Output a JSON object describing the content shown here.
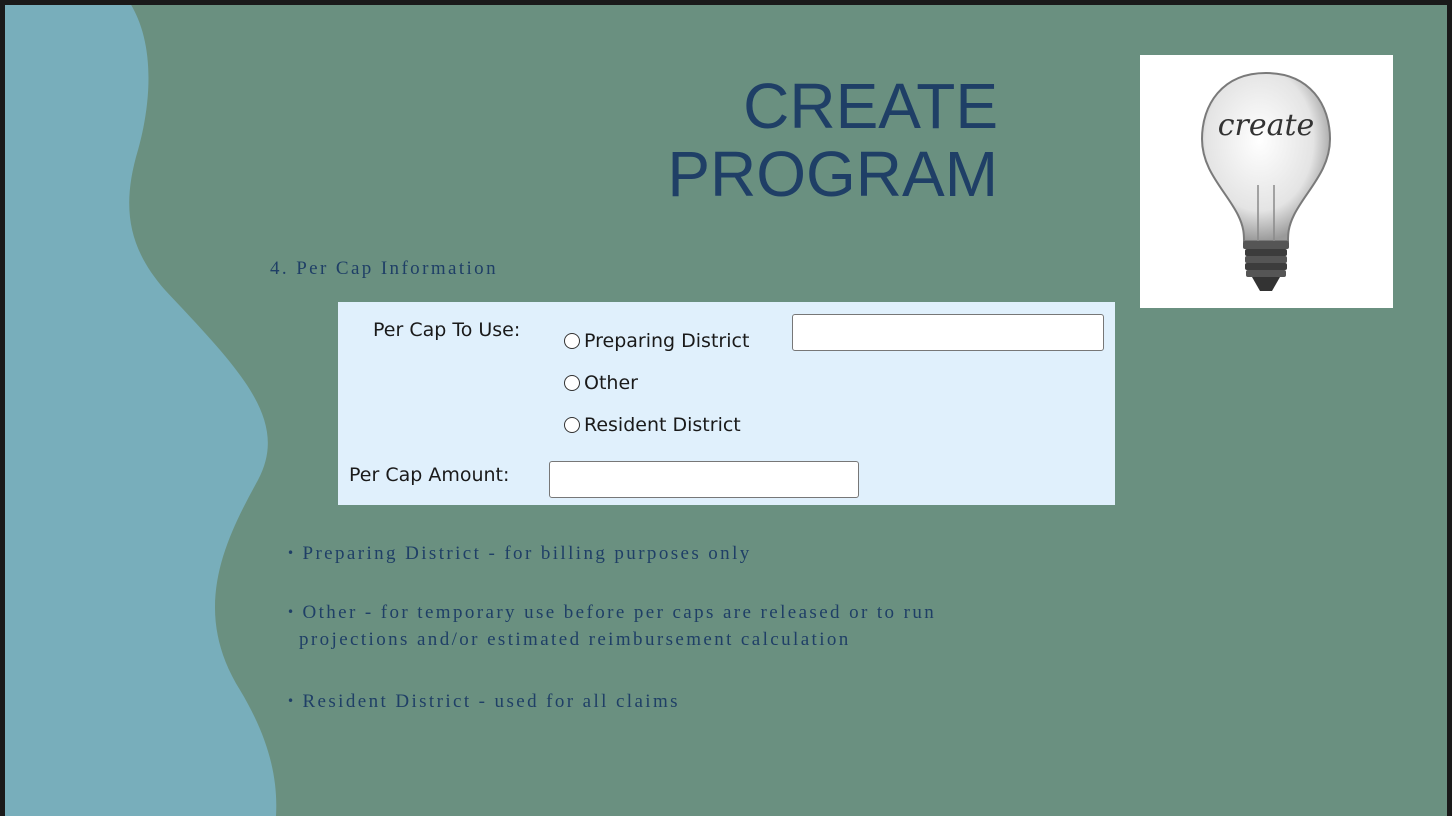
{
  "slide": {
    "title_line1": "CREATE",
    "title_line2": "PROGRAM",
    "bulb_word": "create",
    "section_heading": "4. Per Cap Information"
  },
  "form": {
    "per_cap_to_use_label": "Per Cap To Use:",
    "options": [
      {
        "label": "Preparing District",
        "selected": false
      },
      {
        "label": "Other",
        "selected": false
      },
      {
        "label": "Resident District",
        "selected": false
      }
    ],
    "preparing_district_value": "",
    "per_cap_amount_label": "Per Cap Amount:",
    "per_cap_amount_value": ""
  },
  "bullets": [
    {
      "line1": "Preparing District - for billing purposes only",
      "line2": ""
    },
    {
      "line1": "Other - for temporary use before per caps are released or to run",
      "line2": "projections and/or estimated reimbursement calculation"
    },
    {
      "line1": "Resident District - used for all claims",
      "line2": ""
    }
  ],
  "colors": {
    "background": "#6a9080",
    "wave": "#78aebb",
    "title": "#1f3f66",
    "panel": "#e0f0fc"
  },
  "icons": {
    "bullet": "bullet-dot-icon",
    "lightbulb": "lightbulb-icon"
  }
}
